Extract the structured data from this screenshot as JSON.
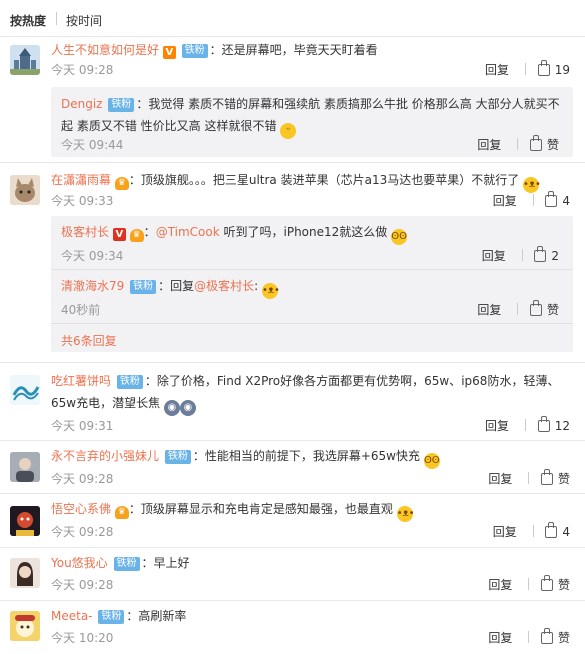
{
  "sort": {
    "hot": "按热度",
    "time": "按时间"
  },
  "actions": {
    "reply": "回复",
    "like": "赞"
  },
  "colors": {
    "username": "#eb7350",
    "badge": "#6ab3e8",
    "meta": "#999999"
  },
  "comments": [
    {
      "user": "人生不如意如何是好",
      "badge": "铁粉",
      "text": "：还是屏幕吧，毕竟天天盯着看",
      "time": "今天 09:28",
      "likes": "19",
      "replies": [
        {
          "user": "Dengiz",
          "badge": "铁粉",
          "text": "：我觉得 素质不错的屏幕和强续航 素质搞那么牛批 价格那么高 大部分人就买不起 素质又不错 性价比又高 这样就很不错",
          "time": "今天 09:44",
          "likes": "赞"
        }
      ]
    },
    {
      "user": "在瀟瀟雨幕",
      "text": "：顶级旗舰。。。把三星ultra 装进苹果（芯片a13马达也要苹果）不就行了",
      "time": "今天 09:33",
      "likes": "4",
      "replies": [
        {
          "user": "极客村长",
          "mention": "@TimCook",
          "text": " 听到了吗，iPhone12就这么做",
          "time": "今天 09:34",
          "likes": "2"
        },
        {
          "user": "清澈海水79",
          "badge": "铁粉",
          "text": "：回复",
          "mention": "@极客村长",
          "text2": ":",
          "time": "40秒前",
          "likes": "赞"
        }
      ],
      "more": "共6条回复"
    },
    {
      "user": "吃红薯饼吗",
      "badge": "铁粉",
      "text": "：除了价格，Find X2Pro好像各方面都更有优势啊，65w、ip68防水，轻薄、65w充电，潜望长焦",
      "time": "今天 09:31",
      "likes": "12"
    },
    {
      "user": "永不言弃的小强妹儿",
      "badge": "铁粉",
      "text": "：性能相当的前提下，我选屏幕+65w快充",
      "time": "今天 09:28",
      "likes": "赞"
    },
    {
      "user": "悟空心系佛",
      "text": "：顶级屏幕显示和充电肯定是感知最强，也最直观",
      "time": "今天 09:28",
      "likes": "4"
    },
    {
      "user": "You悠我心",
      "badge": "铁粉",
      "text": "：早上好",
      "time": "今天 09:28",
      "likes": "赞"
    },
    {
      "user": "Meeta-",
      "badge": "铁粉",
      "text": "：高刷新率",
      "time": "今天 10:20",
      "likes": "赞"
    }
  ]
}
